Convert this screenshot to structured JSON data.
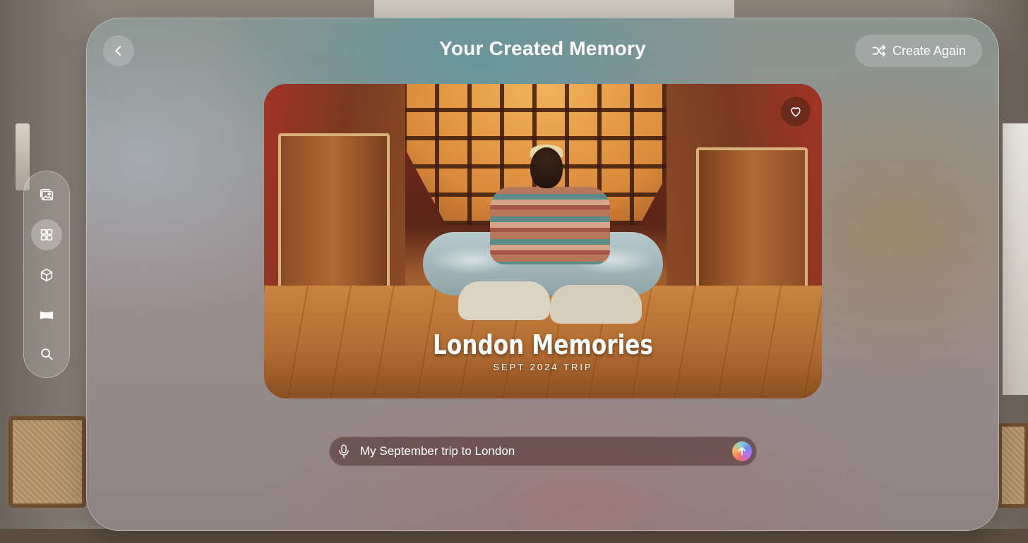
{
  "header": {
    "title": "Your Created Memory",
    "create_again_label": "Create Again"
  },
  "memory": {
    "title": "London Memories",
    "subtitle": "SEPT 2024 TRIP"
  },
  "prompt": {
    "value": "My September trip to London"
  },
  "tab_bar": {
    "items": [
      {
        "icon": "photos-icon",
        "active": false
      },
      {
        "icon": "grid-icon",
        "active": true
      },
      {
        "icon": "cube-icon",
        "active": false
      },
      {
        "icon": "panorama-icon",
        "active": false
      },
      {
        "icon": "search-icon",
        "active": false
      }
    ]
  },
  "colors": {
    "text": "#ffffff",
    "send_gradient": [
      "#f26a6a",
      "#f2b45a",
      "#8fd3c7",
      "#6a8ef2",
      "#c06af2"
    ]
  }
}
